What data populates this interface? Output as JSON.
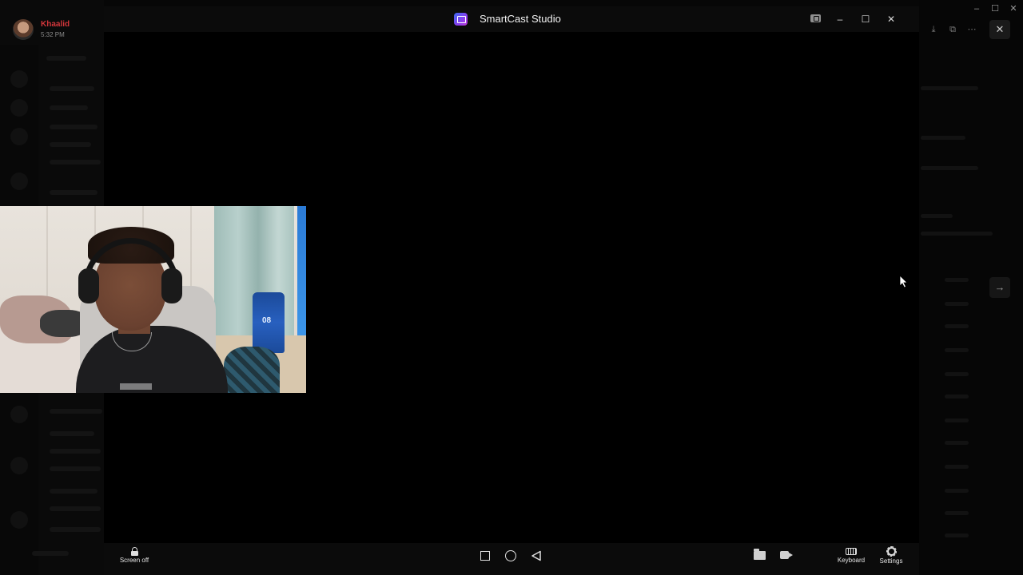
{
  "window": {
    "title": "SmartCast Studio"
  },
  "background_app": {
    "user": {
      "name": "Khaalid",
      "time": "5:32 PM"
    },
    "close_icon": "close-icon",
    "next_icon": "arrow-right-icon"
  },
  "title_controls": {
    "pip": "picture-in-picture-icon",
    "minimize": "–",
    "maximize": "☐",
    "close": "✕"
  },
  "system_controls": {
    "minimize": "–",
    "maximize": "☐",
    "close": "✕"
  },
  "toolbar": {
    "screen_off_label": "Screen off",
    "keyboard_label": "Keyboard",
    "settings_label": "Settings",
    "nav_buttons": [
      "recents",
      "home",
      "back"
    ],
    "icons": [
      "lock-icon",
      "square-icon",
      "circle-icon",
      "back-triangle-icon",
      "folder-icon",
      "camera-icon",
      "keyboard-icon",
      "settings-icon"
    ]
  },
  "colors": {
    "accent_logo_start": "#3b6cf2",
    "accent_logo_end": "#c23bd6",
    "username": "#d3363b",
    "background": "#000000"
  }
}
